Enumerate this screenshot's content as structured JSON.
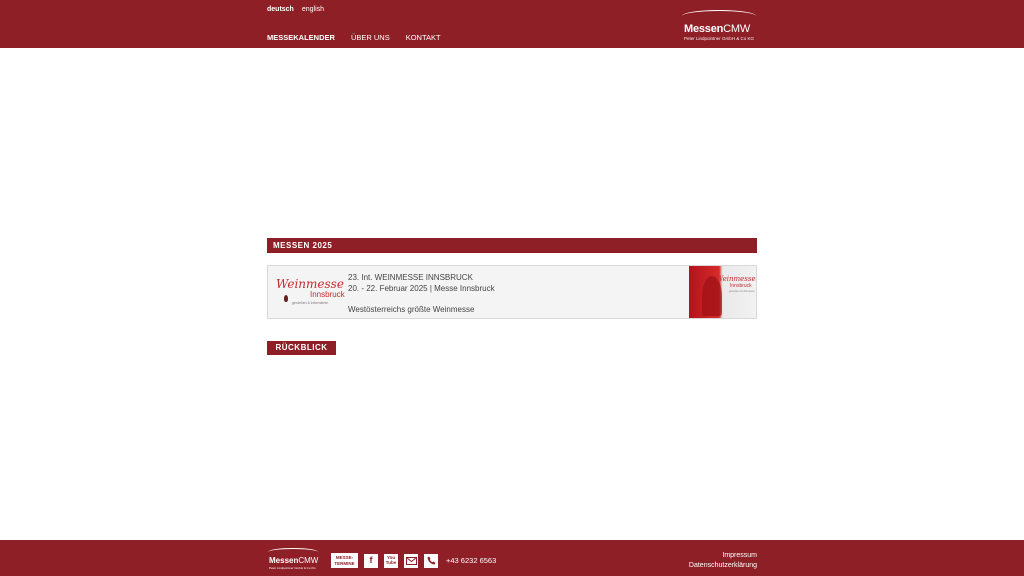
{
  "header": {
    "languages": [
      {
        "label": "deutsch",
        "active": true
      },
      {
        "label": "english",
        "active": false
      }
    ],
    "nav": [
      {
        "label": "MESSEKALENDER",
        "active": true
      },
      {
        "label": "ÜBER UNS",
        "active": false
      },
      {
        "label": "KONTAKT",
        "active": false
      }
    ],
    "logo": {
      "name_bold": "Messen",
      "name_light": "CMW",
      "tagline": "Peter Lindpointner GmbH & Co KG"
    }
  },
  "main": {
    "section_title": "MESSEN 2025",
    "event": {
      "logo_script": "Weinmesse",
      "logo_city": "Innsbruck",
      "logo_tagline": "genießen & informieren",
      "title": "23. Int. WEINMESSE INNSBRUCK",
      "date_location": "20. - 22. Februar 2025 | Messe Innsbruck",
      "description": "Westösterreichs größte Weinmesse",
      "thumb_script": "Weinmesse",
      "thumb_city": "Innsbruck",
      "thumb_tagline": "genießen & informieren"
    },
    "review_label": "RÜCKBLICK"
  },
  "footer": {
    "logo": {
      "name_bold": "Messen",
      "name_light": "CMW",
      "tagline": "Peter Lindpointner GmbH & Co KG"
    },
    "badge_line1": "MESSE-",
    "badge_line2": "TERMINE",
    "facebook_glyph": "f",
    "youtube_line1": "You",
    "youtube_line2": "Tube",
    "phone": "+43 6232 6563",
    "links": [
      "Impressum",
      "Datenschutzerklärung"
    ]
  },
  "colors": {
    "brand": "#8f1f27",
    "accent_red": "#c62b2f",
    "background": "#ffffff"
  },
  "icons": [
    "facebook-icon",
    "youtube-icon",
    "mail-icon",
    "phone-icon"
  ]
}
